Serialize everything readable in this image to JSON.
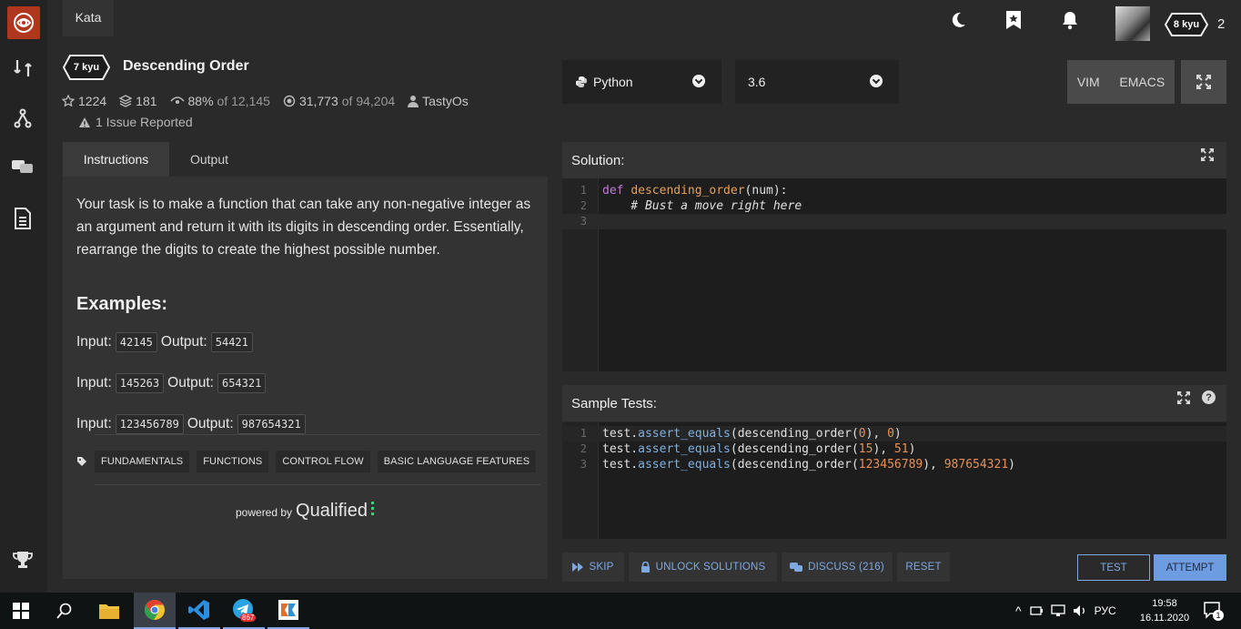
{
  "topbar": {
    "tab_label": "Kata",
    "user_rank": "8 kyu",
    "honor": "2"
  },
  "kata": {
    "rank": "7 kyu",
    "title": "Descending Order",
    "stars": "1224",
    "collections": "181",
    "satisfaction": "88%",
    "satisfaction_of": "of 12,145",
    "completed": "31,773",
    "completed_of": "of 94,204",
    "author": "TastyOs",
    "issues": "1 Issue Reported"
  },
  "language": {
    "selected": "Python"
  },
  "version": {
    "selected": "3.6"
  },
  "editor_modes": [
    "VIM",
    "EMACS"
  ],
  "tabs": {
    "instructions": "Instructions",
    "output": "Output"
  },
  "instructions": {
    "text": "Your task is to make a function that can take any non-negative integer as an argument and return it with its digits in descending order. Essentially, rearrange the digits to create the highest possible number.",
    "examples_heading": "Examples:",
    "input_label": "Input:",
    "output_label": "Output:",
    "examples": [
      {
        "input": "42145",
        "output": "54421"
      },
      {
        "input": "145263",
        "output": "654321"
      },
      {
        "input": "123456789",
        "output": "987654321"
      }
    ],
    "tags": [
      "FUNDAMENTALS",
      "FUNCTIONS",
      "CONTROL FLOW",
      "BASIC LANGUAGE FEATURES"
    ],
    "powered_small": "powered by",
    "powered_brand": "Qualified"
  },
  "solution": {
    "title": "Solution:",
    "lines": [
      {
        "n": "1",
        "def": "def",
        "fn": "descending_order",
        "rest": "(num):"
      },
      {
        "n": "2",
        "comment": "    # Bust a move right here"
      },
      {
        "n": "3"
      }
    ]
  },
  "sample_tests": {
    "title": "Sample Tests:",
    "lines": [
      {
        "n": "1",
        "obj": "test.",
        "meth": "assert_equals",
        "a": "(descending_order(",
        "arg": "0",
        "b": "), ",
        "exp": "0",
        "c": ")"
      },
      {
        "n": "2",
        "obj": "test.",
        "meth": "assert_equals",
        "a": "(descending_order(",
        "arg": "15",
        "b": "), ",
        "exp": "51",
        "c": ")"
      },
      {
        "n": "3",
        "obj": "test.",
        "meth": "assert_equals",
        "a": "(descending_order(",
        "arg": "123456789",
        "b": "), ",
        "exp": "987654321",
        "c": ")"
      }
    ]
  },
  "actions": {
    "skip": "SKIP",
    "unlock": "UNLOCK SOLUTIONS",
    "discuss": "DISCUSS (216)",
    "reset": "RESET",
    "test": "TEST",
    "attempt": "ATTEMPT"
  },
  "taskbar": {
    "telegram_badge": "867",
    "lang": "РУС",
    "time": "19:58",
    "date": "16.11.2020",
    "notif_count": "1"
  },
  "colors": {
    "brand_red": "#b1361e",
    "accent_blue": "#6d9ce0",
    "bg": "#2a2a2b"
  }
}
